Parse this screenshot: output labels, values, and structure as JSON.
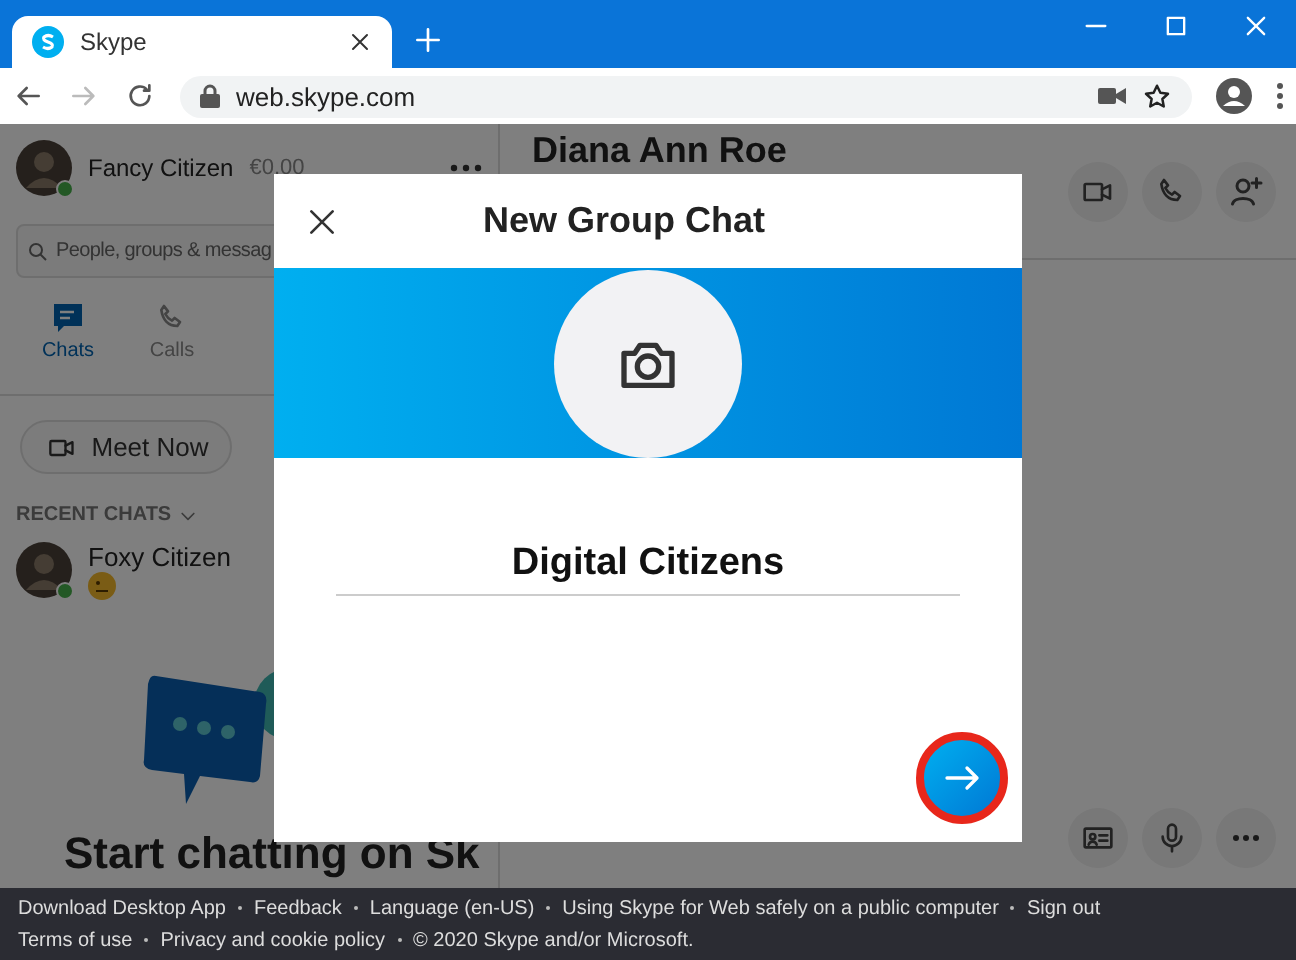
{
  "browser": {
    "tab_title": "Skype",
    "url": "web.skype.com",
    "forward_disabled": true
  },
  "sidebar": {
    "profile": {
      "name": "Fancy Citizen",
      "credit": "€0,00",
      "online": true
    },
    "search": {
      "placeholder": "People, groups & messag"
    },
    "nav": [
      {
        "label": "Chats",
        "kind": "chat",
        "selected": true
      },
      {
        "label": "Calls",
        "kind": "call",
        "selected": false
      }
    ],
    "meet_now": "Meet Now",
    "recent_header": "RECENT CHATS",
    "recent": [
      {
        "name": "Foxy Citizen",
        "online": true
      }
    ],
    "empty_title": "Start chatting on Sk"
  },
  "conversation": {
    "title": "Diana Ann Roe"
  },
  "dialog": {
    "title": "New Group Chat",
    "name_value": "Digital Citizens",
    "next_highlighted": true
  },
  "footer": {
    "rows": [
      [
        "Download Desktop App",
        "Feedback",
        "Language (en-US)",
        "Using Skype for Web safely on a public computer",
        "Sign out"
      ],
      [
        "Terms of use",
        "Privacy and cookie policy",
        "© 2020 Skype and/or Microsoft."
      ]
    ]
  }
}
